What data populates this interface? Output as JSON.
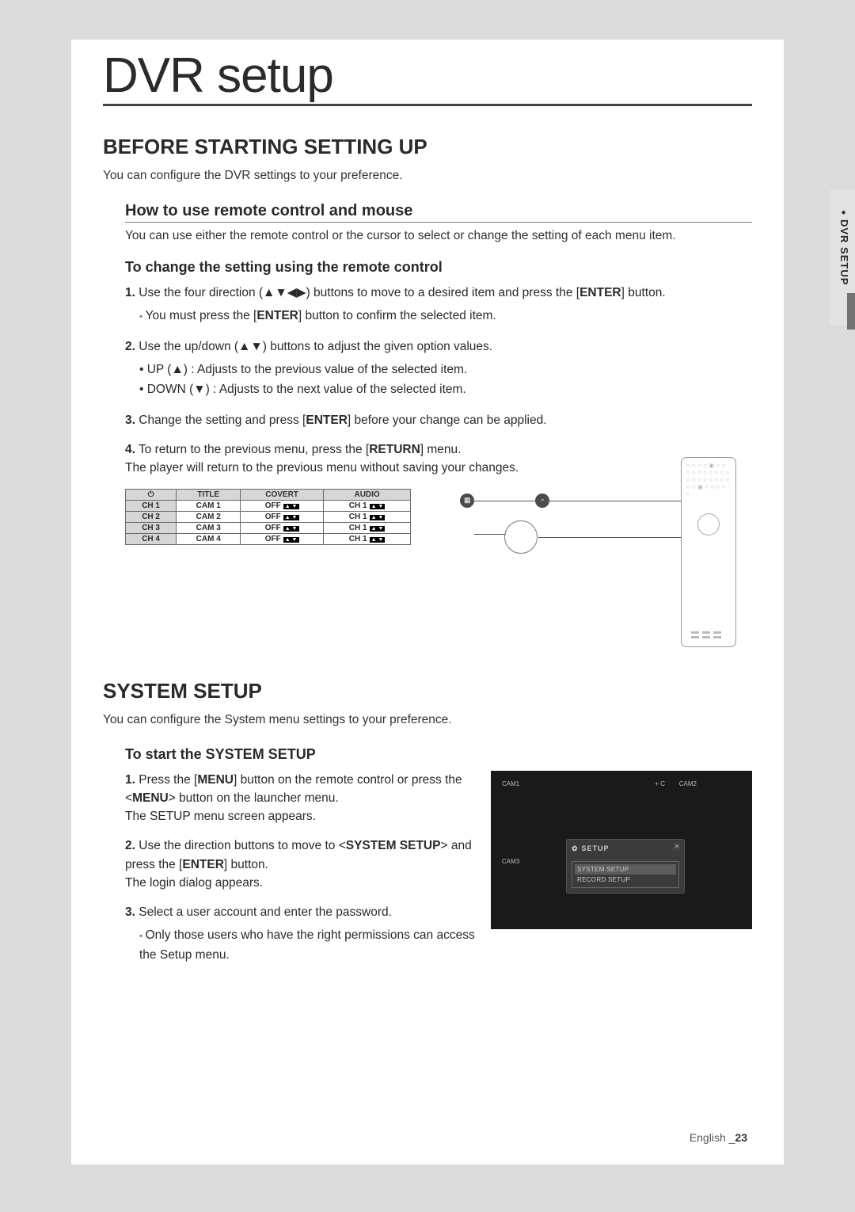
{
  "side_tab": {
    "label": "DVR SETUP"
  },
  "page_title": "DVR setup",
  "sec1": {
    "heading": "BEFORE STARTING SETTING UP",
    "intro": "You can configure the DVR settings to your preference.",
    "sub1": {
      "heading": "How to use remote control and mouse",
      "intro": "You can use either the remote control or the cursor to select or change the setting of each menu item."
    },
    "sub2": {
      "heading": "To change the setting using the remote control",
      "steps": {
        "s1": {
          "num": "1.",
          "text_a": "Use the four direction (▲▼◀▶) buttons to move to a desired item and press the [",
          "enter": "ENTER",
          "text_b": "] button.",
          "note_a": "You must press the [",
          "note_enter": "ENTER",
          "note_b": "] button to confirm the selected item."
        },
        "s2": {
          "num": "2.",
          "text": "Use the up/down (▲▼) buttons to adjust the given option values.",
          "sub_up": "UP (▲) : Adjusts to the previous value of the selected item.",
          "sub_down": "DOWN (▼) : Adjusts to the next value of the selected item."
        },
        "s3": {
          "num": "3.",
          "text_a": "Change the setting and press [",
          "enter": "ENTER",
          "text_b": "] before your change can be applied."
        },
        "s4": {
          "num": "4.",
          "text_a": "To return to the previous menu, press the [",
          "return": "RETURN",
          "text_b": "] menu.",
          "text_c": "The player will return to the previous menu without saving your changes."
        }
      }
    }
  },
  "table": {
    "headers": {
      "icon": "⏻",
      "title": "TITLE",
      "covert": "COVERT",
      "audio": "AUDIO"
    },
    "rows": [
      {
        "ch": "CH 1",
        "title": "CAM 1",
        "covert": "OFF",
        "audio": "CH 1"
      },
      {
        "ch": "CH 2",
        "title": "CAM 2",
        "covert": "OFF",
        "audio": "CH 1"
      },
      {
        "ch": "CH 3",
        "title": "CAM 3",
        "covert": "OFF",
        "audio": "CH 1"
      },
      {
        "ch": "CH 4",
        "title": "CAM 4",
        "covert": "OFF",
        "audio": "CH 1"
      }
    ],
    "spinner_glyph": "▲ ▼"
  },
  "sec2": {
    "heading": "SYSTEM SETUP",
    "intro": "You can configure the System menu settings to your preference.",
    "sub1": {
      "heading": "To start the SYSTEM SETUP",
      "steps": {
        "s1": {
          "num": "1.",
          "a": "Press the [",
          "menu1": "MENU",
          "b": "] button on the remote control or press the <",
          "menu2": "MENU",
          "c": "> button on the launcher menu.",
          "d": "The SETUP menu screen appears."
        },
        "s2": {
          "num": "2.",
          "a": "Use the direction buttons to move to <",
          "sys": "SYSTEM SETUP",
          "b": "> and press the [",
          "enter": "ENTER",
          "c": "] button.",
          "d": "The login dialog appears."
        },
        "s3": {
          "num": "3.",
          "a": "Select a user account and enter the password.",
          "note": "Only those users who have the right permissions can access the Setup menu."
        }
      }
    }
  },
  "sys_fig": {
    "cam1": "CAM1",
    "cam2": "CAM2",
    "cam3": "CAM3",
    "topright": "+ C",
    "popup_title": "SETUP",
    "menu_system": "SYSTEM SETUP",
    "menu_record": "RECORD SETUP",
    "close": "×"
  },
  "footer": {
    "lang": "English",
    "sep": "_",
    "page": "23"
  }
}
